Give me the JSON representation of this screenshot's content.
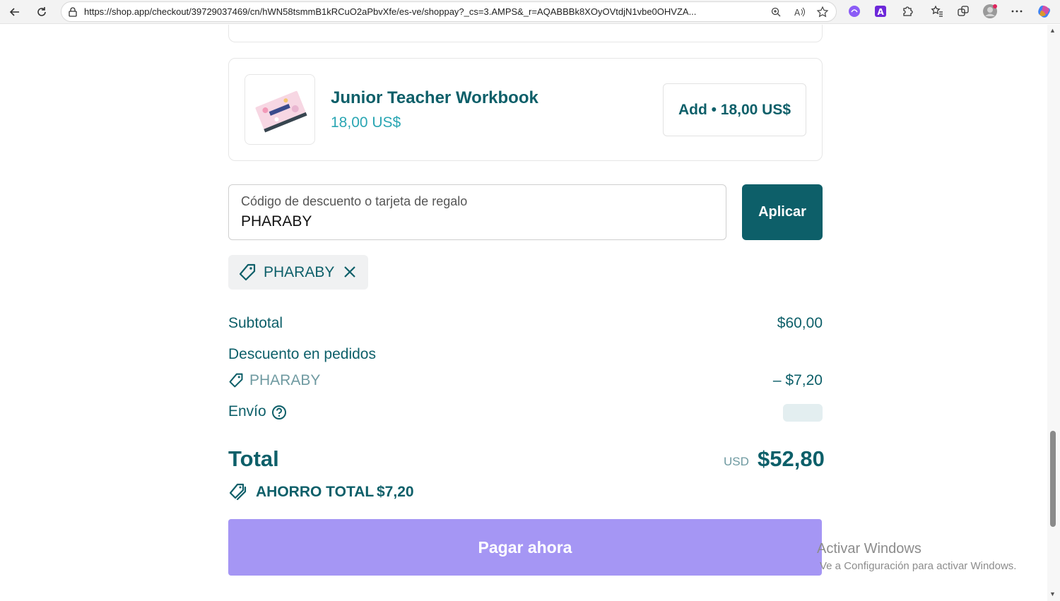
{
  "browser": {
    "url": "https://shop.app/checkout/39729037469/cn/hWN58tsmmB1kRCuO2aPbvXfe/es-ve/shoppay?_cs=3.AMPS&_r=AQABBBk8XOyOVtdjN1vbe0OHVZA..."
  },
  "product": {
    "name": "Junior Teacher Workbook",
    "price": "18,00 US$",
    "add_label": "Add • 18,00 US$"
  },
  "discount": {
    "label": "Código de descuento o tarjeta de regalo",
    "value": "PHARABY",
    "apply_label": "Aplicar"
  },
  "applied_code": {
    "code": "PHARABY"
  },
  "summary": {
    "subtotal_label": "Subtotal",
    "subtotal_value": "$60,00",
    "order_discount_label": "Descuento en pedidos",
    "discount_code": "PHARABY",
    "discount_value": "– $7,20",
    "shipping_label": "Envío"
  },
  "total": {
    "label": "Total",
    "currency": "USD",
    "value": "$52,80"
  },
  "savings": {
    "label": "AHORRO TOTAL",
    "value": "$7,20"
  },
  "pay_button": {
    "label": "Pagar ahora"
  },
  "watermark": {
    "line1": "Activar Windows",
    "line2": "Ve a Configuración para activar Windows."
  },
  "colors": {
    "accent": "#0d5f69",
    "price": "#2aa6b3",
    "pay_button": "#a596f4"
  }
}
